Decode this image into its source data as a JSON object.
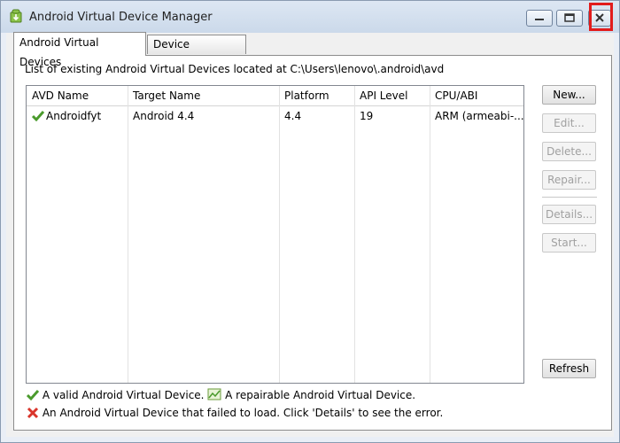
{
  "window": {
    "title": "Android Virtual Device Manager",
    "icons": [
      "android-download-icon",
      "minimize-icon",
      "maximize-icon",
      "close-icon"
    ]
  },
  "tabs": [
    {
      "label": "Android Virtual Devices",
      "active": true
    },
    {
      "label": "Device Definitions",
      "active": false
    }
  ],
  "main": {
    "path_text": "List of existing Android Virtual Devices located at C:\\Users\\lenovo\\.android\\avd"
  },
  "table": {
    "columns": [
      "AVD Name",
      "Target Name",
      "Platform",
      "API Level",
      "CPU/ABI"
    ],
    "rows": [
      {
        "status_icon": "valid-check-icon",
        "name": "Androidfyt",
        "target": "Android 4.4",
        "platform": "4.4",
        "api": "19",
        "cpu": "ARM (armeabi-..."
      }
    ]
  },
  "buttons": {
    "new": "New...",
    "edit": "Edit...",
    "delete": "Delete...",
    "repair": "Repair...",
    "details": "Details...",
    "start": "Start...",
    "refresh": "Refresh"
  },
  "legend": {
    "valid": "A valid Android Virtual Device.",
    "repairable": "A repairable Android Virtual Device.",
    "failed": "An Android Virtual Device that failed to load. Click 'Details' to see the error."
  },
  "colors": {
    "check_green": "#4a9a2c",
    "error_red": "#d9352b",
    "highlight_red": "#e21c1c"
  }
}
